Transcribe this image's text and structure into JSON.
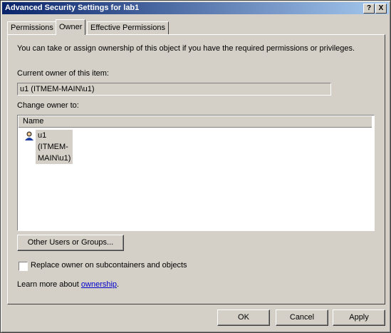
{
  "window": {
    "title": "Advanced Security Settings for lab1",
    "help_btn": "?",
    "close_btn": "X"
  },
  "tabs": [
    {
      "label": "Permissions"
    },
    {
      "label": "Owner",
      "active": true
    },
    {
      "label": "Effective Permissions"
    }
  ],
  "owner": {
    "intro": "You can take or assign ownership of this object if you have the required permissions or privileges.",
    "current_label": "Current owner of this item:",
    "current_value": "u1 (ITMEM-MAIN\\u1)",
    "change_label": "Change owner to:",
    "list_header": "Name",
    "list_items": [
      {
        "name": "u1 (ITMEM-MAIN\\u1)",
        "icon": "user-icon"
      }
    ],
    "other_users_btn": "Other Users or Groups...",
    "replace_checkbox_label": "Replace owner on subcontainers and objects",
    "replace_checked": false,
    "learn_prefix": "Learn more about ",
    "learn_link": "ownership",
    "learn_suffix": "."
  },
  "footer": {
    "ok": "OK",
    "cancel": "Cancel",
    "apply": "Apply"
  },
  "colors": {
    "title_start": "#0a246a",
    "title_end": "#a6caf0",
    "face": "#d4d0c8",
    "link": "#0000cc"
  }
}
